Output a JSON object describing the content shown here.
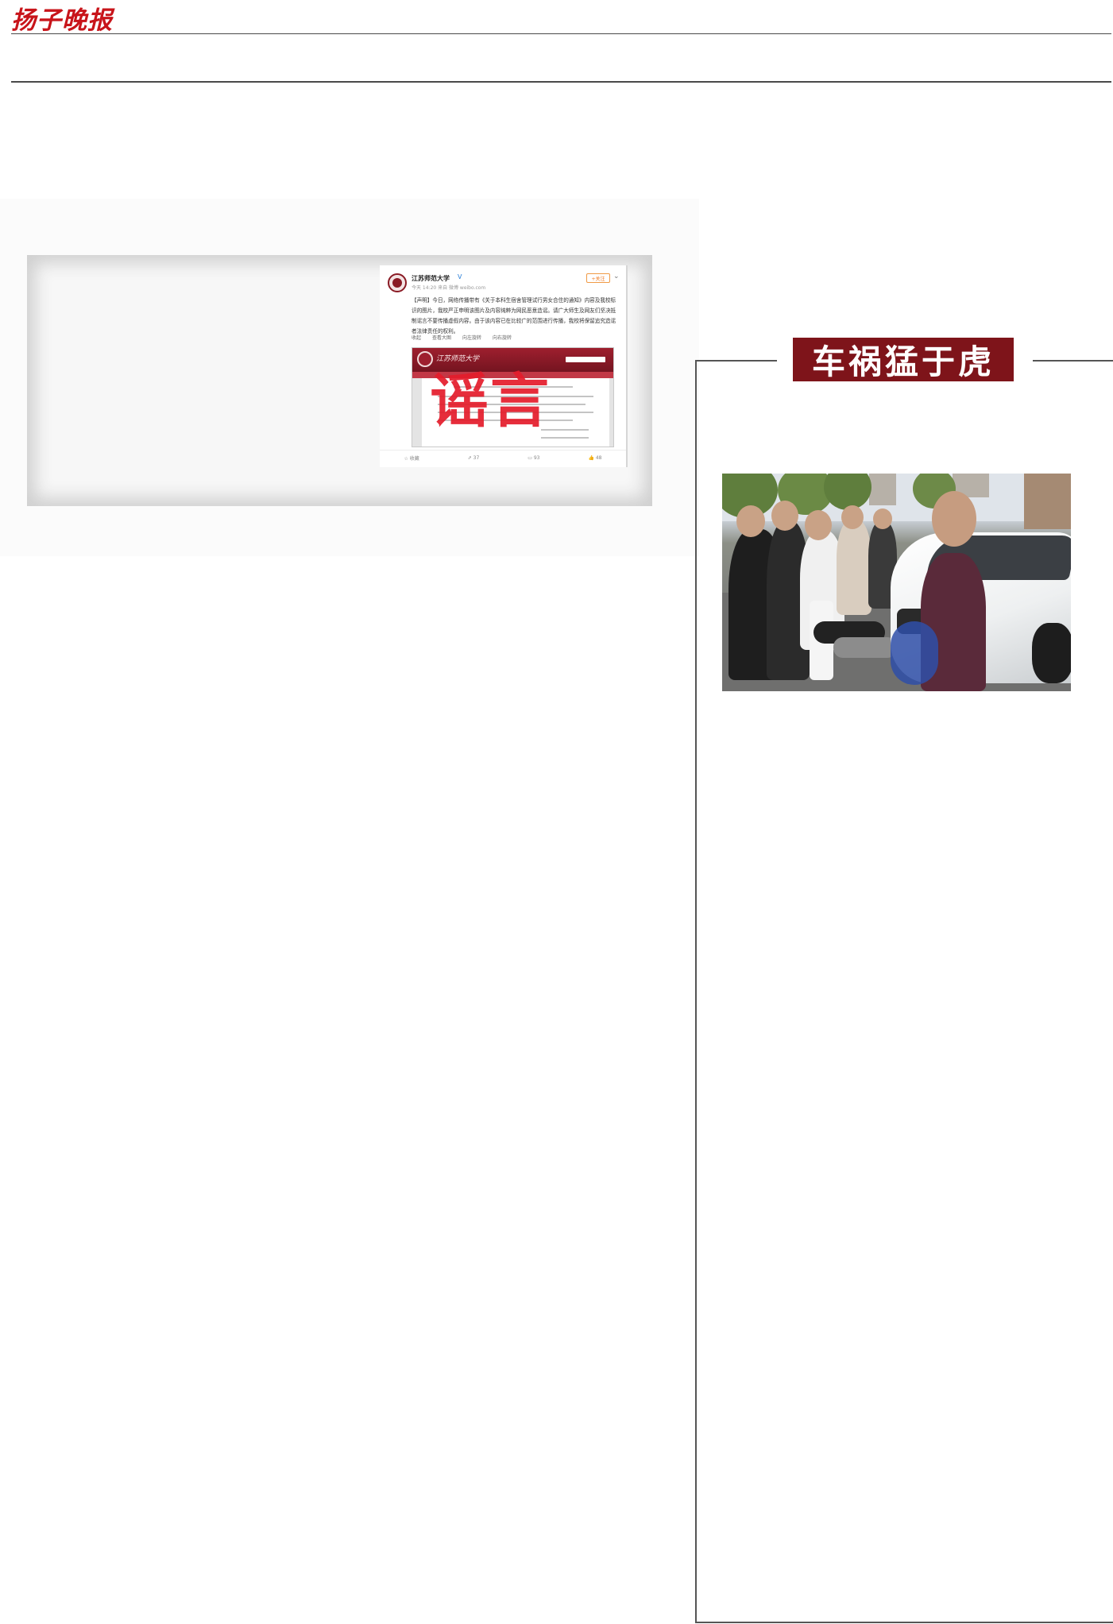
{
  "masthead": {
    "logo_text": "扬子晚报"
  },
  "figure": {
    "weibo_post": {
      "account_name": "江苏师范大学",
      "verified_mark": "V",
      "meta_line": "今天 14:20 来自 微博 weibo.com",
      "follow_label": "+关注",
      "chevron_icon": "chevron-down-icon",
      "body_text": "【声明】今日，网络传播带有《关于本科生宿舍管理试行男女合住的通知》内容及我校标识的图片，我校严正申明该图片及内容纯粹为网民恶意造谣。请广大师生及网友们坚决抵制谣言不要传播虚假内容。由于该内容已在比较广的范围进行传播，我校将保留追究造谣者法律责任的权利。",
      "actions": [
        "收起",
        "查看大图",
        "向左旋转",
        "向右旋转"
      ],
      "footer": [
        {
          "icon": "star-icon",
          "label": "收藏"
        },
        {
          "icon": "share-icon",
          "label": "37"
        },
        {
          "icon": "comment-icon",
          "label": "93"
        },
        {
          "icon": "like-icon",
          "label": "48"
        }
      ]
    },
    "embedded_screenshot": {
      "site_name": "江苏师范大学",
      "stamp_text": "谣言"
    }
  },
  "sidebar": {
    "title": "车祸猛于虎"
  },
  "colors": {
    "masthead_red": "#c8141a",
    "title_banner": "#7e141a",
    "stamp_red": "#e41c2b",
    "rule_gray": "#4a4a4a"
  }
}
